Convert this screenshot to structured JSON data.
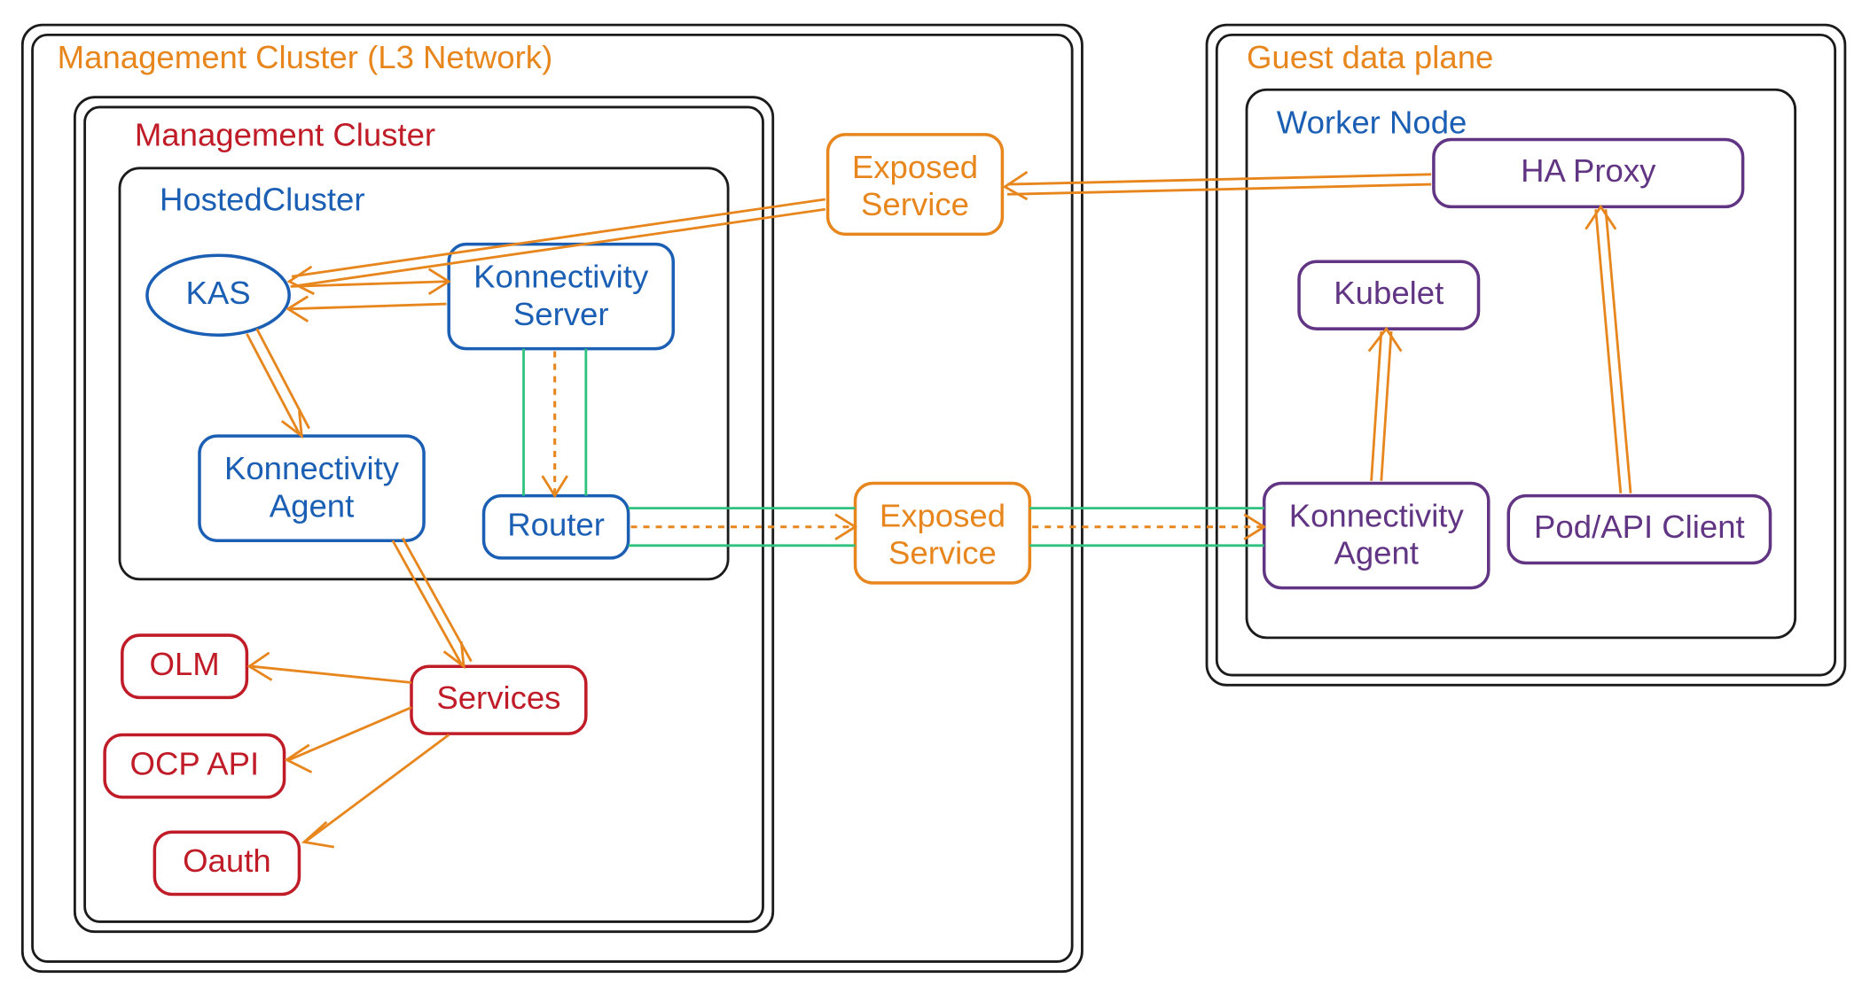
{
  "mgmt_l3": {
    "title": "Management Cluster (L3 Network)"
  },
  "mgmt_cluster": {
    "title": "Management Cluster",
    "hosted_cluster": {
      "title": "HostedCluster",
      "kas": "KAS",
      "konnectivity_server": "Konnectivity\nServer",
      "konnectivity_agent": "Konnectivity\nAgent",
      "router": "Router"
    },
    "services": "Services",
    "olm": "OLM",
    "ocp_api": "OCP API",
    "oauth": "Oauth"
  },
  "exposed_service_top": "Exposed\nService",
  "exposed_service_mid": "Exposed\nService",
  "guest": {
    "title": "Guest data plane",
    "worker_node": {
      "title": "Worker Node",
      "ha_proxy": "HA Proxy",
      "kubelet": "Kubelet",
      "konnectivity_agent": "Konnectivity\nAgent",
      "pod_api_client": "Pod/API Client"
    }
  }
}
